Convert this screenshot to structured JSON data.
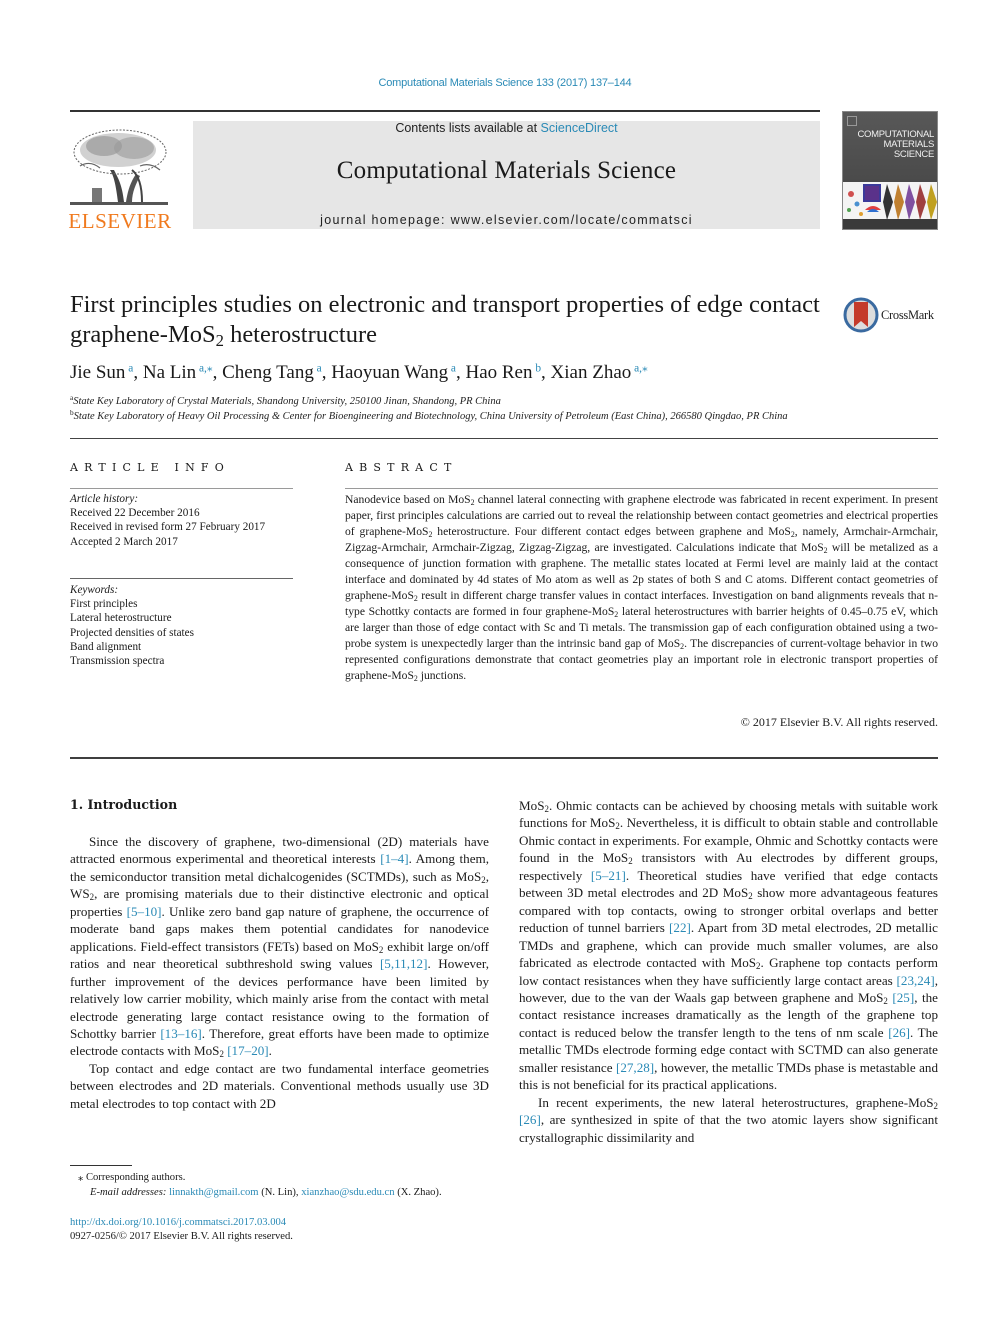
{
  "header": {
    "journal_ref": "Computational Materials Science 133 (2017) 137–144",
    "contents_prefix": "Contents lists available at ",
    "contents_link": "ScienceDirect",
    "journal_title": "Computational Materials Science",
    "homepage_prefix": "journal homepage: ",
    "homepage_url": "www.elsevier.com/locate/commatsci",
    "publisher_logo_text": "ELSEVIER",
    "cover_title_lines": [
      "COMPUTATIONAL",
      "MATERIALS",
      "SCIENCE"
    ],
    "crossmark_label": "CrossMark"
  },
  "article": {
    "title_part1": "First principles studies on electronic and transport properties of edge contact graphene-MoS",
    "title_sub": "2",
    "title_part2": " heterostructure",
    "authors": [
      {
        "name": "Jie Sun",
        "marks": "a",
        "sep": ", "
      },
      {
        "name": "Na Lin",
        "marks": "a,⁎",
        "sep": ", "
      },
      {
        "name": "Cheng Tang",
        "marks": "a",
        "sep": ", "
      },
      {
        "name": "Haoyuan Wang",
        "marks": "a",
        "sep": ", "
      },
      {
        "name": "Hao Ren",
        "marks": "b",
        "sep": ", "
      },
      {
        "name": "Xian Zhao",
        "marks": "a,⁎",
        "sep": ""
      }
    ],
    "affiliations": [
      {
        "mark": "a",
        "text": "State Key Laboratory of Crystal Materials, Shandong University, 250100 Jinan, Shandong, PR China"
      },
      {
        "mark": "b",
        "text": "State Key Laboratory of Heavy Oil Processing & Center for Bioengineering and Biotechnology, China University of Petroleum (East China), 266580 Qingdao, PR China"
      }
    ]
  },
  "article_info": {
    "heading": "ARTICLE INFO",
    "history_label": "Article history:",
    "history": [
      "Received 22 December 2016",
      "Received in revised form 27 February 2017",
      "Accepted 2 March 2017"
    ],
    "keywords_label": "Keywords:",
    "keywords": [
      "First principles",
      "Lateral heterostructure",
      "Projected densities of states",
      "Band alignment",
      "Transmission spectra"
    ]
  },
  "abstract": {
    "heading": "ABSTRACT",
    "segments": [
      "Nanodevice based on MoS",
      "2",
      " channel lateral connecting with graphene electrode was fabricated in recent experiment. In present paper, first principles calculations are carried out to reveal the relationship between contact geometries and electrical properties of graphene-MoS",
      "2",
      " heterostructure. Four different contact edges between graphene and MoS",
      "2",
      ", namely, Armchair-Armchair, Zigzag-Armchair, Armchair-Zigzag, Zigzag-Zigzag, are investigated. Calculations indicate that MoS",
      "2",
      " will be metalized as a consequence of junction formation with graphene. The metallic states located at Fermi level are mainly laid at the contact interface and dominated by 4d states of Mo atom as well as 2p states of both S and C atoms. Different contact geometries of graphene-MoS",
      "2",
      " result in different charge transfer values in contact interfaces. Investigation on band alignments reveals that n-type Schottky contacts are formed in four graphene-MoS",
      "2",
      " lateral heterostructures with barrier heights of 0.45–0.75 eV, which are larger than those of edge contact with Sc and Ti metals. The transmission gap of each configuration obtained using a two-probe system is unexpectedly larger than the intrinsic band gap of MoS",
      "2",
      ". The discrepancies of current-voltage behavior in two represented configurations demonstrate that contact geometries play an important role in electronic transport properties of graphene-MoS",
      "2",
      " junctions."
    ],
    "copyright": "© 2017 Elsevier B.V. All rights reserved."
  },
  "introduction": {
    "heading": "1. Introduction",
    "left_paragraphs": [
      [
        {
          "t": "Since the discovery of graphene, two-dimensional (2D) materials have attracted enormous experimental and theoretical interests "
        },
        {
          "ref": "[1–4]"
        },
        {
          "t": ". Among them, the semiconductor transition metal dichalcogenides (SCTMDs), such as MoS"
        },
        {
          "sub": "2"
        },
        {
          "t": ", WS"
        },
        {
          "sub": "2"
        },
        {
          "t": ", are promising materials due to their distinctive electronic and optical properties "
        },
        {
          "ref": "[5–10]"
        },
        {
          "t": ". Unlike zero band gap nature of graphene, the occurrence of moderate band gaps makes them potential candidates for nanodevice applications. Field-effect transistors (FETs) based on MoS"
        },
        {
          "sub": "2"
        },
        {
          "t": " exhibit large on/off ratios and near theoretical subthreshold swing values "
        },
        {
          "ref": "[5,11,12]"
        },
        {
          "t": ". However, further improvement of the devices performance have been limited by relatively low carrier mobility, which mainly arise from the contact with metal electrode generating large contact resistance owing to the formation of Schottky barrier "
        },
        {
          "ref": "[13–16]"
        },
        {
          "t": ". Therefore, great efforts have been made to optimize electrode contacts with MoS"
        },
        {
          "sub": "2"
        },
        {
          "t": " "
        },
        {
          "ref": "[17–20]"
        },
        {
          "t": "."
        }
      ],
      [
        {
          "t": "Top contact and edge contact are two fundamental interface geometries between electrodes and 2D materials. Conventional methods usually use 3D metal electrodes to top contact with 2D"
        }
      ]
    ],
    "right_paragraphs": [
      [
        {
          "t": "MoS"
        },
        {
          "sub": "2"
        },
        {
          "t": ". Ohmic contacts can be achieved by choosing metals with suitable work functions for MoS"
        },
        {
          "sub": "2"
        },
        {
          "t": ". Nevertheless, it is difficult to obtain stable and controllable Ohmic contact in experiments. For example, Ohmic and Schottky contacts were found in the MoS"
        },
        {
          "sub": "2"
        },
        {
          "t": " transistors with Au electrodes by different groups, respectively "
        },
        {
          "ref": "[5–21]"
        },
        {
          "t": ". Theoretical studies have verified that edge contacts between 3D metal electrodes and 2D MoS"
        },
        {
          "sub": "2"
        },
        {
          "t": " show more advantageous features compared with top contacts, owing to stronger orbital overlaps and better reduction of tunnel barriers "
        },
        {
          "ref": "[22]"
        },
        {
          "t": ". Apart from 3D metal electrodes, 2D metallic TMDs and graphene, which can provide much smaller volumes, are also fabricated as electrode contacted with MoS"
        },
        {
          "sub": "2"
        },
        {
          "t": ". Graphene top contacts perform low contact resistances when they have sufficiently large contact areas "
        },
        {
          "ref": "[23,24]"
        },
        {
          "t": ", however, due to the van der Waals gap between graphene and MoS"
        },
        {
          "sub": "2"
        },
        {
          "t": " "
        },
        {
          "ref": "[25]"
        },
        {
          "t": ", the contact resistance increases dramatically as the length of the graphene top contact is reduced below the transfer length to the tens of nm scale "
        },
        {
          "ref": "[26]"
        },
        {
          "t": ". The metallic TMDs electrode forming edge contact with SCTMD can also generate smaller resistance "
        },
        {
          "ref": "[27,28]"
        },
        {
          "t": ", however, the metallic TMDs phase is metastable and this is not beneficial for its practical applications."
        }
      ],
      [
        {
          "t": "In recent experiments, the new lateral heterostructures, graphene-MoS"
        },
        {
          "sub": "2"
        },
        {
          "t": " "
        },
        {
          "ref": "[26]"
        },
        {
          "t": ", are synthesized in spite of that the two atomic layers show significant crystallographic dissimilarity and"
        }
      ]
    ]
  },
  "footnotes": {
    "corresponding": "⁎ Corresponding authors.",
    "email_label": "E-mail addresses: ",
    "emails": [
      {
        "addr": "linnakth@gmail.com",
        "who": " (N. Lin), "
      },
      {
        "addr": "xianzhao@sdu.edu.cn",
        "who": " (X. Zhao)."
      }
    ],
    "doi": "http://dx.doi.org/10.1016/j.commatsci.2017.03.004",
    "issn_line": "0927-0256/© 2017 Elsevier B.V. All rights reserved."
  },
  "colors": {
    "link": "#2a8ab6",
    "elsevier_orange": "#f07a1e",
    "masthead_bg": "#e6e6e6"
  }
}
